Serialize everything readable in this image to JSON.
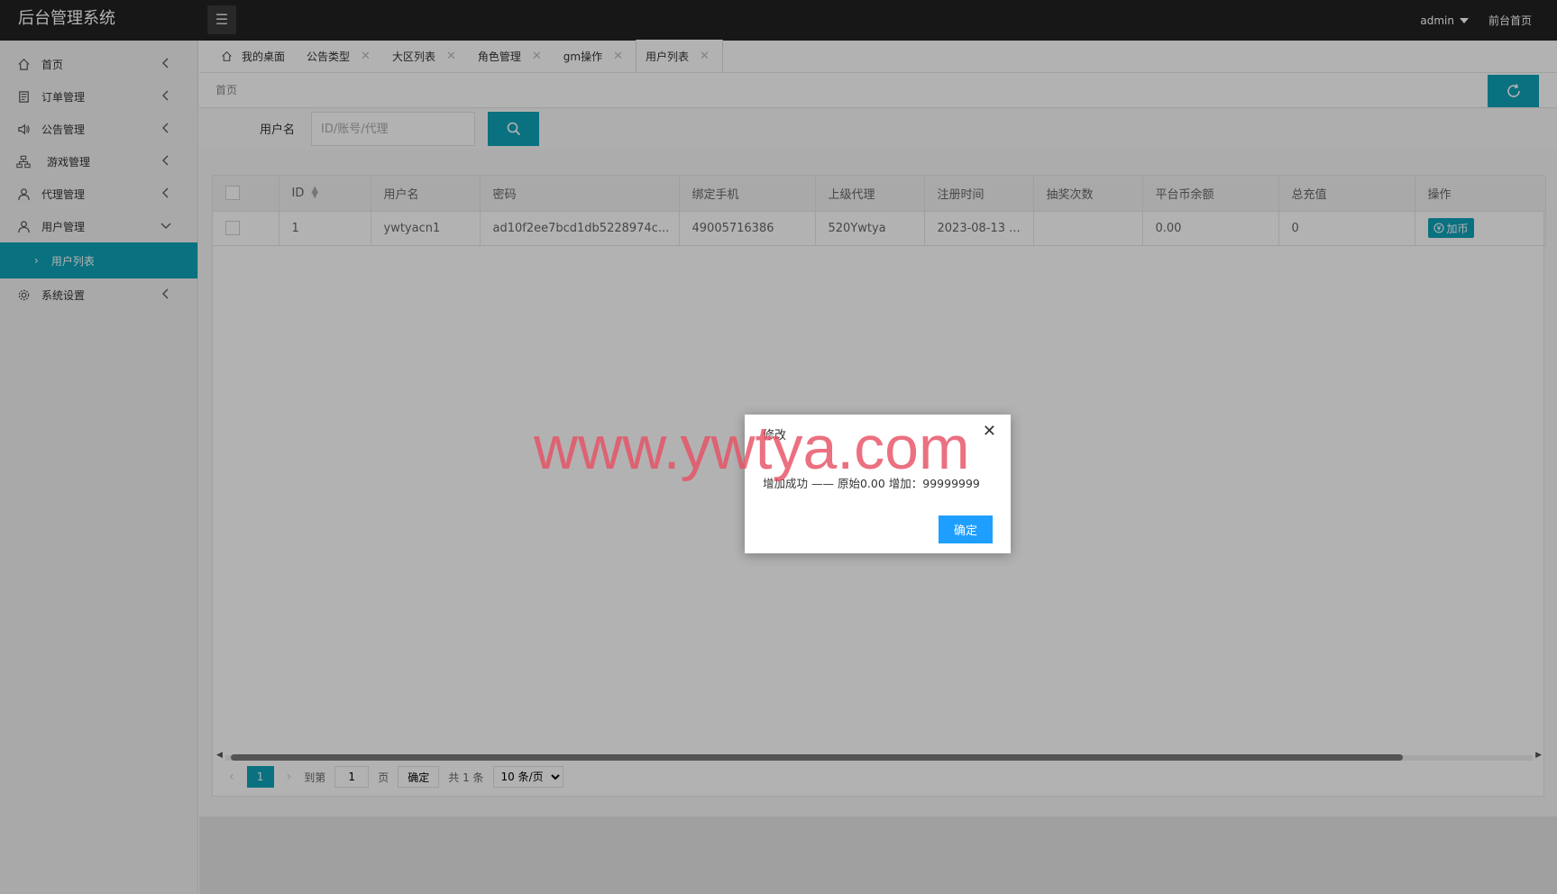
{
  "header": {
    "title": "后台管理系统",
    "user": "admin",
    "front_link": "前台首页"
  },
  "sidebar": {
    "items": [
      {
        "label": "首页",
        "icon": "home-icon"
      },
      {
        "label": "订单管理",
        "icon": "order-icon"
      },
      {
        "label": "公告管理",
        "icon": "speaker-icon"
      },
      {
        "label": "游戏管理",
        "icon": "sitemap-icon"
      },
      {
        "label": "代理管理",
        "icon": "agent-icon"
      },
      {
        "label": "用户管理",
        "icon": "user-icon"
      }
    ],
    "sub_item": "用户列表",
    "settings": {
      "label": "系统设置",
      "icon": "gear-icon"
    }
  },
  "tabs": [
    "我的桌面",
    "公告类型",
    "大区列表",
    "角色管理",
    "gm操作",
    "用户列表"
  ],
  "breadcrumb": "首页",
  "search": {
    "label": "用户名",
    "placeholder": "ID/账号/代理"
  },
  "table": {
    "columns": [
      "ID",
      "用户名",
      "密码",
      "绑定手机",
      "上级代理",
      "注册时间",
      "抽奖次数",
      "平台币余额",
      "总充值",
      "操作"
    ],
    "rows": [
      {
        "id": "1",
        "username": "ywtyacn1",
        "password": "ad10f2ee7bcd1db5228974c...",
        "phone": "49005716386",
        "agent": "520Ywtya",
        "reg_time": "2023-08-13 ...",
        "draws": "",
        "balance": "0.00",
        "total": "0",
        "action": "加币"
      }
    ]
  },
  "pager": {
    "current": "1",
    "goto_label": "到第",
    "goto_value": "1",
    "page_label": "页",
    "confirm": "确定",
    "total": "共 1 条",
    "page_size": "10 条/页"
  },
  "dialog": {
    "title": "修改",
    "message": "增加成功 —— 原始0.00 增加：99999999",
    "ok": "确定"
  },
  "watermark": "www.ywtya.com",
  "colors": {
    "accent": "#0fa2b8",
    "header": "#222222",
    "ok_button": "#1e9fff"
  }
}
